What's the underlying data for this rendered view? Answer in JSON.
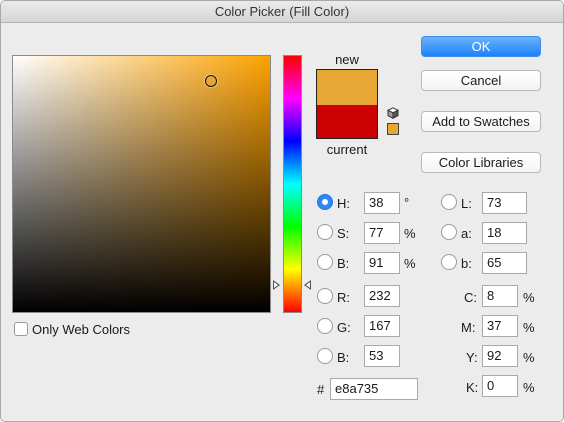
{
  "window": {
    "title": "Color Picker (Fill Color)"
  },
  "colors": {
    "new": "#e8a735",
    "current": "#cc0000",
    "pure_hue": "#ffa200",
    "accent": "#2f86f6"
  },
  "swatch": {
    "new_label": "new",
    "current_label": "current"
  },
  "icons": {
    "cube": "cube-icon",
    "websafe": "websafe-warning-chip"
  },
  "buttons": {
    "ok": "OK",
    "cancel": "Cancel",
    "add_to_swatches": "Add to Swatches",
    "color_libraries": "Color Libraries"
  },
  "fields": {
    "H": {
      "label": "H:",
      "value": "38",
      "unit": "°",
      "selected": true
    },
    "S": {
      "label": "S:",
      "value": "77",
      "unit": "%"
    },
    "B": {
      "label": "B:",
      "value": "91",
      "unit": "%"
    },
    "R": {
      "label": "R:",
      "value": "232"
    },
    "G": {
      "label": "G:",
      "value": "167"
    },
    "Bl": {
      "label": "B:",
      "value": "53"
    },
    "L": {
      "label": "L:",
      "value": "73"
    },
    "a": {
      "label": "a:",
      "value": "18"
    },
    "b": {
      "label": "b:",
      "value": "65"
    },
    "C": {
      "label": "C:",
      "value": "8",
      "unit": "%"
    },
    "M": {
      "label": "M:",
      "value": "37",
      "unit": "%"
    },
    "Y": {
      "label": "Y:",
      "value": "92",
      "unit": "%"
    },
    "K": {
      "label": "K:",
      "value": "0",
      "unit": "%"
    },
    "hex": {
      "label": "#",
      "value": "e8a735"
    }
  },
  "only_web_colors": {
    "label": "Only Web Colors",
    "checked": false
  }
}
